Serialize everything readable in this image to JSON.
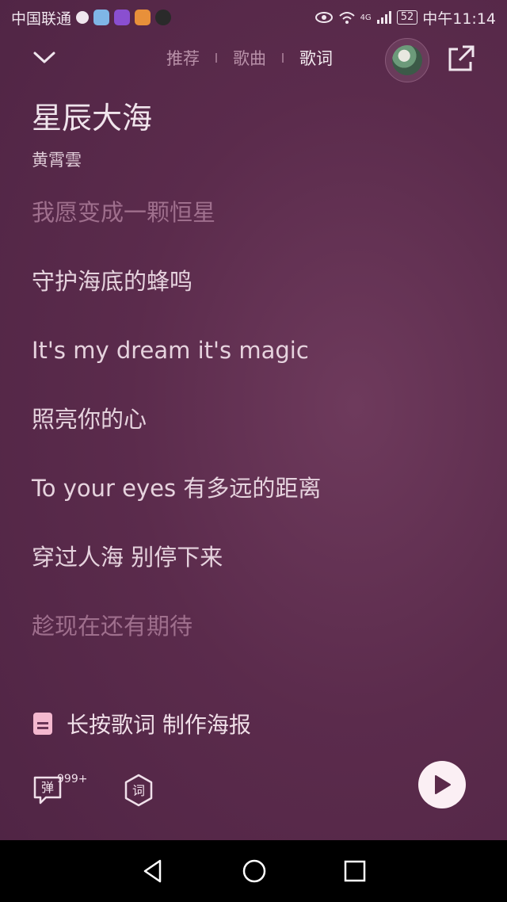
{
  "status_bar": {
    "carrier": "中国联通",
    "network": "4G",
    "battery": "52",
    "time": "中午11:14"
  },
  "nav": {
    "tabs": [
      {
        "label": "推荐",
        "active": false
      },
      {
        "label": "歌曲",
        "active": false
      },
      {
        "label": "歌词",
        "active": true
      }
    ]
  },
  "song": {
    "title": "星辰大海",
    "artist": "黄霄雲"
  },
  "lyrics": [
    {
      "text": "我愿变成一颗恒星",
      "state": "past"
    },
    {
      "text": "守护海底的蜂鸣",
      "state": "normal"
    },
    {
      "text": "It's my dream it's magic",
      "state": "normal"
    },
    {
      "text": "照亮你的心",
      "state": "normal"
    },
    {
      "text": "To your eyes 有多远的距离",
      "state": "normal"
    },
    {
      "text": "穿过人海 别停下来",
      "state": "normal"
    },
    {
      "text": "趁现在还有期待",
      "state": "upcoming"
    }
  ],
  "poster": {
    "label": "长按歌词 制作海报"
  },
  "controls": {
    "danmaku_label": "弹",
    "danmaku_count": "999+",
    "lyrics_label": "词",
    "play_icon": "play-icon"
  },
  "colors": {
    "background": "#5b2b4c",
    "accent": "#f4b8cf"
  }
}
